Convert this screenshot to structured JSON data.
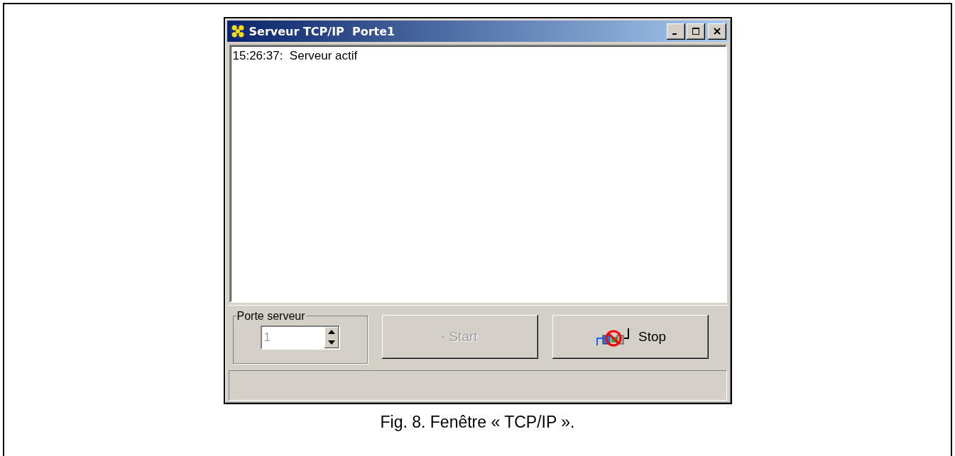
{
  "window": {
    "title": "Serveur TCP/IP  Porte1"
  },
  "log": [
    {
      "text": "15:26:37:  Serveur actif"
    }
  ],
  "port_group": {
    "label": "Porte serveur",
    "value": "1",
    "disabled": true
  },
  "buttons": [
    {
      "label": "Start",
      "kind": "start",
      "disabled": true
    },
    {
      "label": "Stop",
      "kind": "stop",
      "disabled": false
    }
  ],
  "caption": "Fig. 8. Fenêtre « TCP/IP »."
}
